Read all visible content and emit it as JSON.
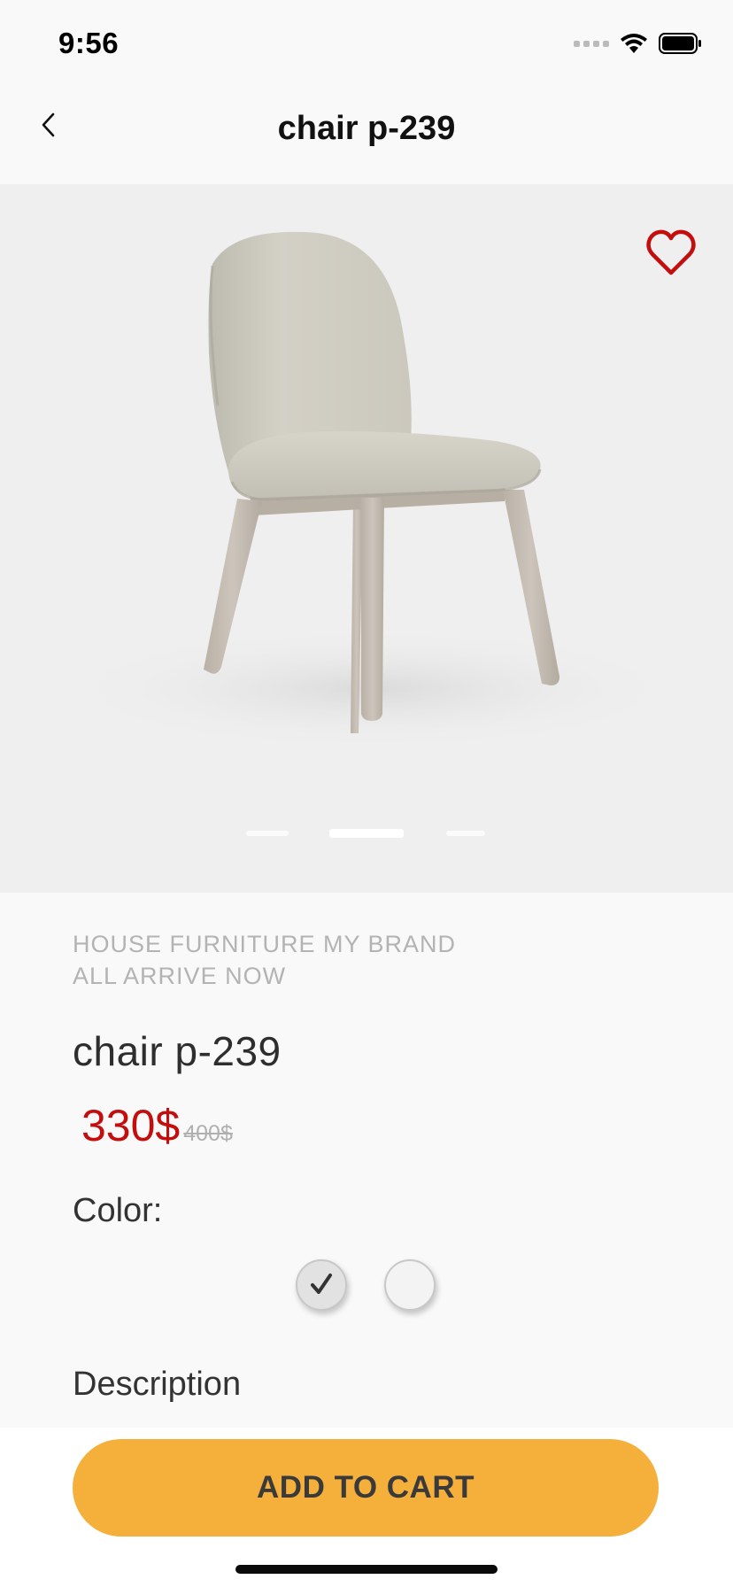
{
  "status_bar": {
    "time": "9:56",
    "icons": [
      "signal-icon",
      "wifi-icon",
      "battery-icon"
    ]
  },
  "nav": {
    "back_icon": "chevron-left-icon",
    "title": "chair p-239"
  },
  "gallery": {
    "favorite_icon": "heart-outline-icon",
    "favorite_color": "#c40d0d",
    "image": "beige upholstered dining chair",
    "page_count": 3,
    "active_page": 2
  },
  "product": {
    "brand_line_1": "HOUSE FURNITURE MY BRAND",
    "brand_line_2": "ALL ARRIVE NOW",
    "name": "chair p-239",
    "price": "330$",
    "old_price": "400$",
    "price_color": "#c40d0d"
  },
  "color_picker": {
    "label": "Color:",
    "options": [
      {
        "color": "#e2e2e2",
        "selected": true,
        "icon": "checkmark-icon"
      },
      {
        "color": "#f3f3f3",
        "selected": false
      }
    ]
  },
  "description": {
    "heading": "Description"
  },
  "cta": {
    "label": "ADD TO CART",
    "color": "#f5af3b"
  }
}
